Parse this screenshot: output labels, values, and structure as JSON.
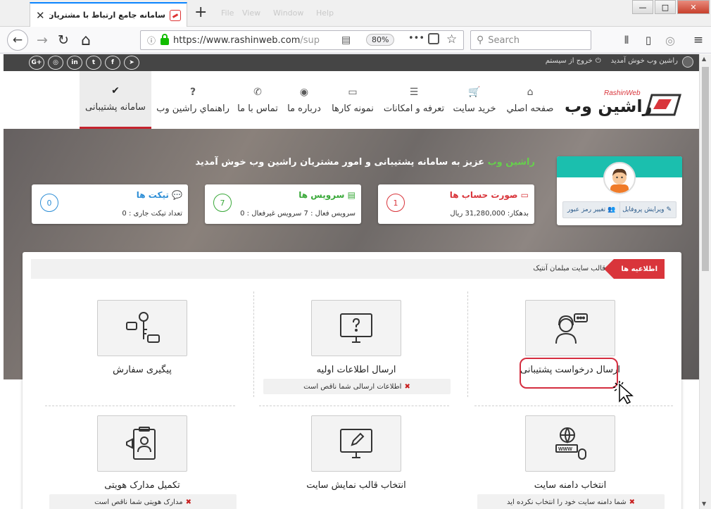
{
  "browser": {
    "tab_title": "سامانه جامع ارتباط با مشتریان راشی",
    "tab_close": "✕",
    "new_tab": "+",
    "faint_menu": [
      "File",
      "View",
      "Window",
      "Help"
    ],
    "url_host": "https://www.rashinweb.com",
    "url_path": "/sup",
    "zoom": "80%",
    "more": "•••",
    "search_placeholder": "Search",
    "window_controls": {
      "minimize": "—",
      "maximize": "□",
      "close": "✕"
    },
    "nav": {
      "back": "←",
      "forward": "→",
      "reload": "↻",
      "home": "⌂"
    }
  },
  "site": {
    "topbar": {
      "welcome": "راشین وب خوش آمدید",
      "logout": "خروج از سیستم",
      "social": [
        "G+",
        "◎",
        "in",
        "t",
        "f",
        "➤"
      ]
    },
    "logo_text": "راشین وب",
    "logo_sub": "RashinWeb",
    "menu": [
      {
        "label": "صفحه اصلي",
        "icon": "home-icon",
        "glyph": "⌂"
      },
      {
        "label": "خريد سايت",
        "icon": "cart-icon",
        "glyph": "🛒"
      },
      {
        "label": "تعرفه و امكانات",
        "icon": "server-icon",
        "glyph": "☰"
      },
      {
        "label": "نمونه كارها",
        "icon": "laptop-icon",
        "glyph": "▭"
      },
      {
        "label": "درباره ما",
        "icon": "globe-icon",
        "glyph": "◉"
      },
      {
        "label": "تماس با ما",
        "icon": "phone-icon",
        "glyph": "✆"
      },
      {
        "label": "راهنماي راشين وب",
        "icon": "question-icon",
        "glyph": "?"
      },
      {
        "label": "سامانه پشتیبانی",
        "icon": "check-icon",
        "glyph": "✔"
      }
    ],
    "hero": {
      "welcome_name": "راشین وب",
      "welcome_rest": " عزیز به سامانه پشتیبانی و امور مشتریان راشین وب خوش آمدید"
    },
    "profile": {
      "edit": "ویرایش پروفایل",
      "change_password": "تغییر رمز عبور"
    },
    "cards": {
      "invoices": {
        "title": "صورت حساب ها",
        "count": "1",
        "sub": "بدهکار: 31,280,000 ریال",
        "color": "#d9353b"
      },
      "services": {
        "title": "سرویس ها",
        "count": "7",
        "sub": "سرویس فعال : 7     سرویس غیرفعال : 0",
        "color": "#3aa93a"
      },
      "tickets": {
        "title": "تیکت ها",
        "count": "0",
        "sub": "تعداد تیکت جاری : 0",
        "color": "#2d8ed6"
      }
    },
    "notice": {
      "label": "اطلاعیه ها",
      "text": "قالب سایت مبلمان آنتیک"
    },
    "tiles": [
      {
        "label": "ارسال درخواست پشتیبانی",
        "icon": "support-agent-icon",
        "warning": ""
      },
      {
        "label": "ارسال اطلاعات اولیه",
        "icon": "monitor-question-icon",
        "warning": "اطلاعات ارسالی شما ناقص است"
      },
      {
        "label": "پیگیری سفارش",
        "icon": "key-chat-icon",
        "warning": ""
      },
      {
        "label": "انتخاب دامنه سایت",
        "icon": "www-globe-icon",
        "warning": "شما دامنه سایت خود را انتخاب نکرده اید"
      },
      {
        "label": "انتخاب قالب نمایش سایت",
        "icon": "monitor-edit-icon",
        "warning": ""
      },
      {
        "label": "تکمیل مدارک هویتی",
        "icon": "id-card-icon",
        "warning": "مدارک هویتی شما ناقص است"
      }
    ],
    "warn_mark": "✖",
    "colors": {
      "accent": "#c5232e",
      "teal": "#1bbfae",
      "topbar": "#454545"
    }
  }
}
